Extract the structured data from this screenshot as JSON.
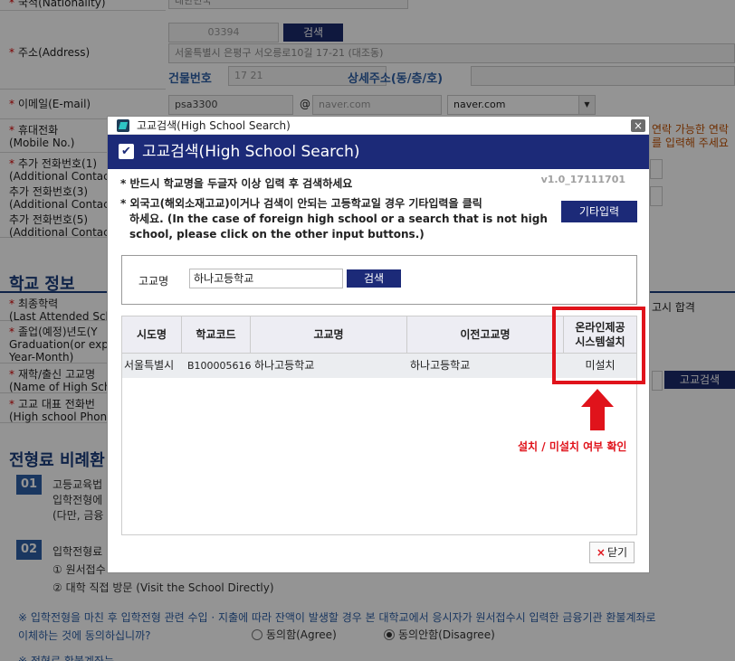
{
  "form": {
    "nationality": {
      "label": "국적(Nationality)",
      "value": "대한민국"
    },
    "address": {
      "label": "주소(Address)",
      "zip": "03394",
      "search_label": "검색",
      "line1": "서울특별시 은평구 서오릉로10길 17-21 (대조동)",
      "building_label": "건물번호",
      "building_value": "17 21",
      "detail_label": "상세주소(동/층/호)"
    },
    "email": {
      "label": "이메일(E-mail)",
      "local": "psa3300",
      "at": "@",
      "domain": "naver.com",
      "select": "naver.com"
    },
    "mobile": {
      "label": "휴대전화",
      "label_en": "(Mobile No.)",
      "hint1": "연락 가능한 연락",
      "hint2": "를 입력해 주세요"
    },
    "extra1": {
      "label": "추가 전화번호(1)",
      "label_en": "(Additional Contact"
    },
    "extra3": {
      "label": "추가 전화번호(3)",
      "label_en": "(Additional Contact"
    },
    "extra5": {
      "label": "추가 전화번호(5)",
      "label_en": "(Additional Contact"
    },
    "school_section": "학교 정보",
    "last_school": {
      "label": "최종학력",
      "label_en": "(Last Attended Sch",
      "hint": "고시 합격"
    },
    "grad_year": {
      "label": "졸업(예정)년도(Y",
      "label_en1": "Graduation(or expe",
      "label_en2": "Year-Month)"
    },
    "school_name": {
      "label": "재학/출신 고교명",
      "label_en": "(Name of High Scho",
      "button": "고교검색"
    },
    "school_phone": {
      "label": "고교 대표 전화번",
      "label_en": "(High school Phone"
    },
    "fee_section": "전형료 비례환",
    "item1": {
      "num": "01",
      "text1": "고등교육법",
      "text2": "입학전형에",
      "text3": "(다만, 금융"
    },
    "item2": {
      "num": "02",
      "text1": "입학전형료",
      "text2": "① 원서접수",
      "text3": "② 대학 직접 방문  (Visit the School Directly)"
    },
    "notice1": "※ 입학전형을 마친 후 입학전형 관련 수입 · 지출에 따라 잔액이 발생할 경우 본 대학교에서 응시자가 원서접수시 입력한 금융기관 환불계좌로",
    "notice2": "이체하는 것에 동의하십니까?",
    "agree": "동의함(Agree)",
    "disagree": "동의안함(Disagree)",
    "notice3": "※ 전형료 환불계좌는 ..."
  },
  "modal": {
    "window_title": "고교검색(High School Search)",
    "header": "고교검색(High School Search)",
    "version": "v1.0_17111701",
    "note1": "* 반드시 학교명을 두글자 이상 입력 후 검색하세요",
    "note2_line1": "* 외국고(해외소재고교)이거나 검색이 안되는 고등학교일 경우 기타입력을 클릭",
    "note2_line2": "하세요. (In the case of foreign high school or a search that is not high",
    "note2_line3": "school, please click on the other input buttons.)",
    "etc_button": "기타입력",
    "search_label": "고교명",
    "search_value": "하나고등학교",
    "search_button": "검색",
    "columns": [
      "시도명",
      "학교코드",
      "고교명",
      "이전고교명",
      "온라인제공",
      "시스템설치"
    ],
    "row": {
      "region": "서울특별시",
      "code": "B100005616",
      "name": "하나고등학교",
      "prev_name": "하나고등학교",
      "installed": "미설치"
    },
    "close_button": "닫기",
    "close_icon": "×"
  },
  "annotation": {
    "text": "설치 / 미설치 여부 확인",
    "color": "#e0131b"
  },
  "colors": {
    "navy": "#1c2a78",
    "section_blue": "#1a3d7c",
    "accent_red": "#e0131b"
  }
}
